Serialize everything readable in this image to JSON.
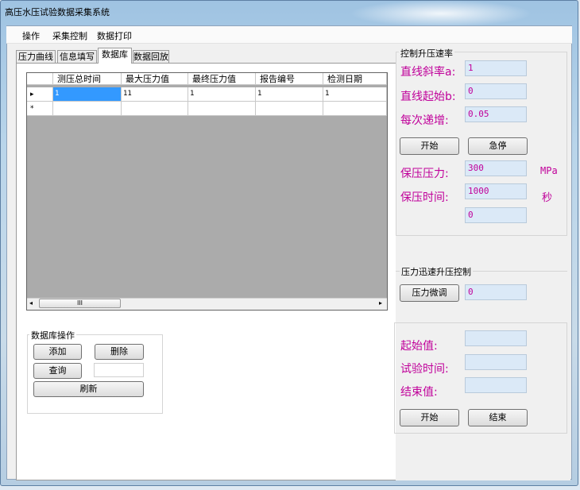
{
  "window": {
    "title": "高压水压试验数据采集系统"
  },
  "menu": [
    "操作",
    "采集控制",
    "数据打印"
  ],
  "tabs": [
    "压力曲线",
    "信息填写",
    "数据库",
    "数据回放"
  ],
  "grid": {
    "columns": [
      "测压总时间",
      "最大压力值",
      "最终压力值",
      "报告编号",
      "检测日期"
    ],
    "rows": [
      [
        "1",
        "11",
        "1",
        "1",
        "1"
      ]
    ],
    "row_markers": [
      "▸",
      "*"
    ],
    "scroll_label": "III"
  },
  "db_ops": {
    "title": "数据库操作",
    "add": "添加",
    "delete": "删除",
    "query": "查询",
    "query_value": "",
    "refresh": "刷新"
  },
  "rate_control": {
    "title": "控制升压速率",
    "slope_label": "直线斜率a:",
    "slope_value": "1",
    "start_label": "直线起始b:",
    "start_value": "0",
    "step_label": "每次递增:",
    "step_value": "0.05",
    "start_btn": "开始",
    "stop_btn": "急停",
    "hold_pressure_label": "保压压力:",
    "hold_pressure_value": "300",
    "hold_pressure_unit": "MPa",
    "hold_time_label": "保压时间:",
    "hold_time_value": "1000",
    "hold_time_unit": "秒",
    "extra_value": "0"
  },
  "fast_control": {
    "title": "压力迅速升压控制",
    "fine_btn": "压力微调",
    "fine_value": "0"
  },
  "bottom_control": {
    "start_label": "起始值:",
    "start_value": "",
    "time_label": "试验时间:",
    "time_value": "",
    "end_label": "结束值:",
    "end_value": "",
    "start_btn": "开始",
    "end_btn": "结束"
  }
}
